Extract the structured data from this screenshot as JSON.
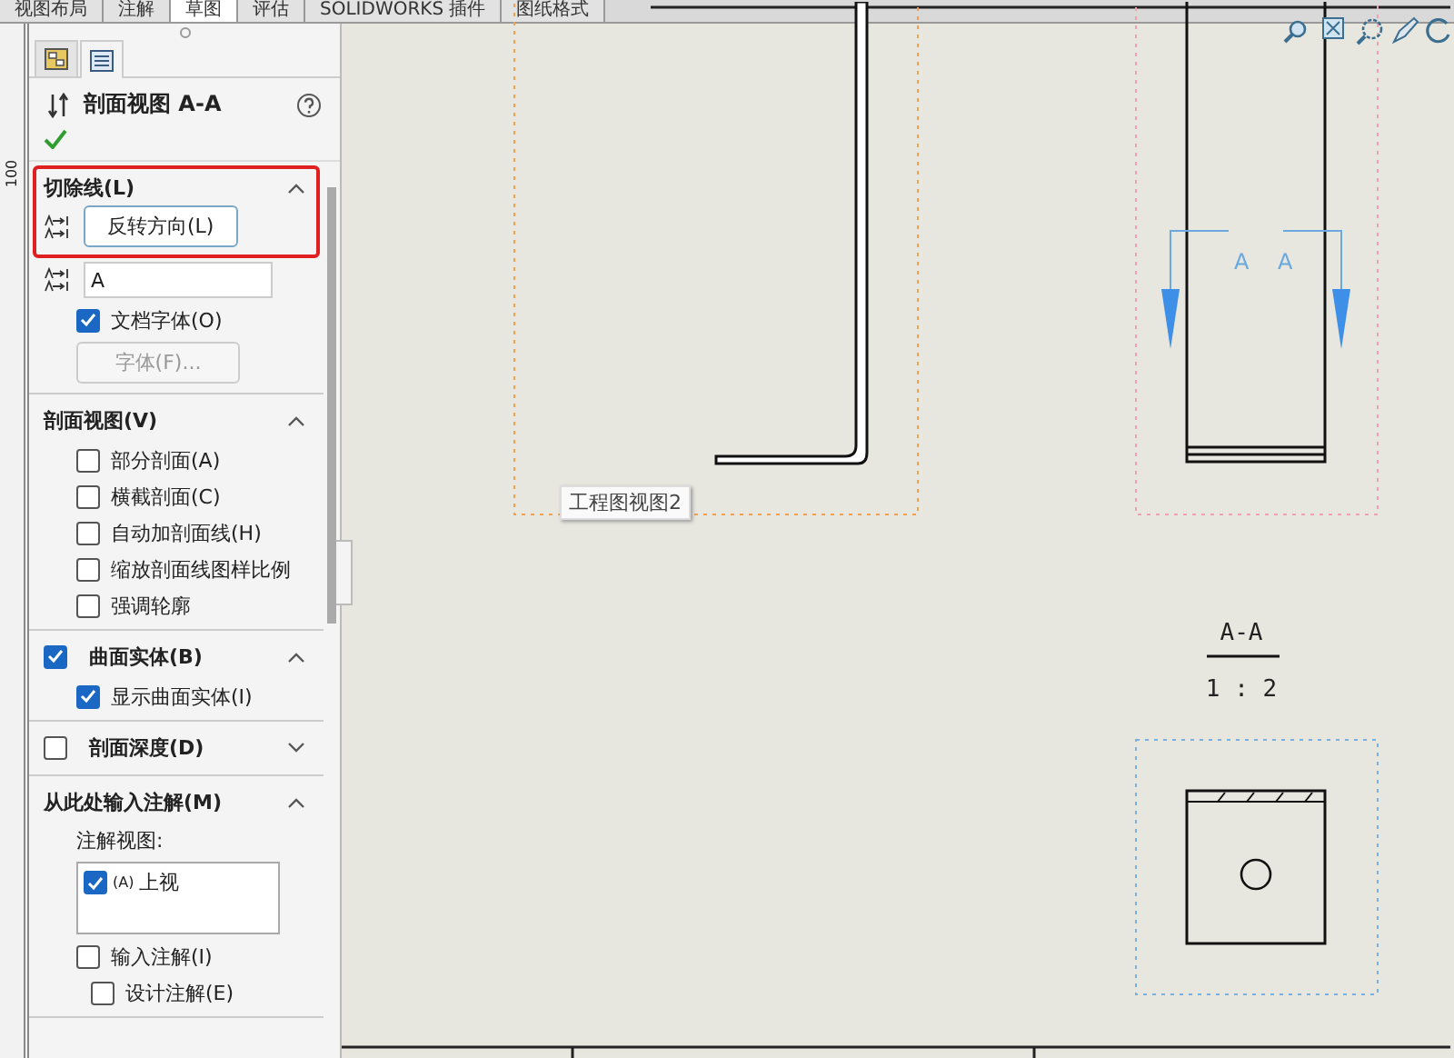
{
  "top_tabs": [
    {
      "label": "视图布局",
      "selected": false
    },
    {
      "label": "注解",
      "selected": false
    },
    {
      "label": "草图",
      "selected": true
    },
    {
      "label": "评估",
      "selected": false
    },
    {
      "label": "SOLIDWORKS 插件",
      "selected": false
    },
    {
      "label": "图纸格式",
      "selected": false
    }
  ],
  "ruler": {
    "label": "100"
  },
  "panel": {
    "tabs": [
      {
        "kind": "feature",
        "selected": false
      },
      {
        "kind": "property",
        "selected": true
      }
    ],
    "title": "剖面视图 A-A",
    "sections": [
      {
        "title": "切除线(L)",
        "expanded": true,
        "highlighted": true,
        "items": [
          {
            "kind": "button",
            "label": "反转方向(L)",
            "disabled": false
          },
          {
            "kind": "field",
            "value": "A"
          },
          {
            "kind": "checkbox",
            "label": "文档字体(O)",
            "checked": true
          },
          {
            "kind": "button",
            "label": "字体(F)...",
            "disabled": true
          }
        ]
      },
      {
        "title": "剖面视图(V)",
        "expanded": true,
        "highlighted": false,
        "items": [
          {
            "kind": "checkbox",
            "label": "部分剖面(A)",
            "checked": false
          },
          {
            "kind": "checkbox",
            "label": "横截剖面(C)",
            "checked": false
          },
          {
            "kind": "checkbox",
            "label": "自动加剖面线(H)",
            "checked": false
          },
          {
            "kind": "checkbox",
            "label": "缩放剖面线图样比例",
            "checked": false
          },
          {
            "kind": "checkbox",
            "label": "强调轮廓",
            "checked": false
          }
        ]
      },
      {
        "title": "曲面实体(B)",
        "expanded": true,
        "highlighted": false,
        "checked": true,
        "items": [
          {
            "kind": "checkbox",
            "label": "显示曲面实体(I)",
            "checked": true
          }
        ]
      },
      {
        "title": "剖面深度(D)",
        "expanded": false,
        "highlighted": false,
        "checked": false
      },
      {
        "title": "从此处输入注解(M)",
        "expanded": true,
        "highlighted": false,
        "items": [
          {
            "kind": "label",
            "label": "注解视图:"
          },
          {
            "kind": "listbox",
            "entries": [
              {
                "key": "(A)",
                "label": "上视",
                "checked": true
              }
            ]
          },
          {
            "kind": "checkbox",
            "label": "输入注解(I)",
            "checked": false
          },
          {
            "kind": "subcheckbox",
            "label": "设计注解(E)",
            "checked": false
          }
        ]
      }
    ]
  },
  "canvas": {
    "tooltip": "工程图视图2",
    "section_letters": [
      "A",
      "A"
    ],
    "view_label": "A-A",
    "scale": "1 : 2"
  }
}
